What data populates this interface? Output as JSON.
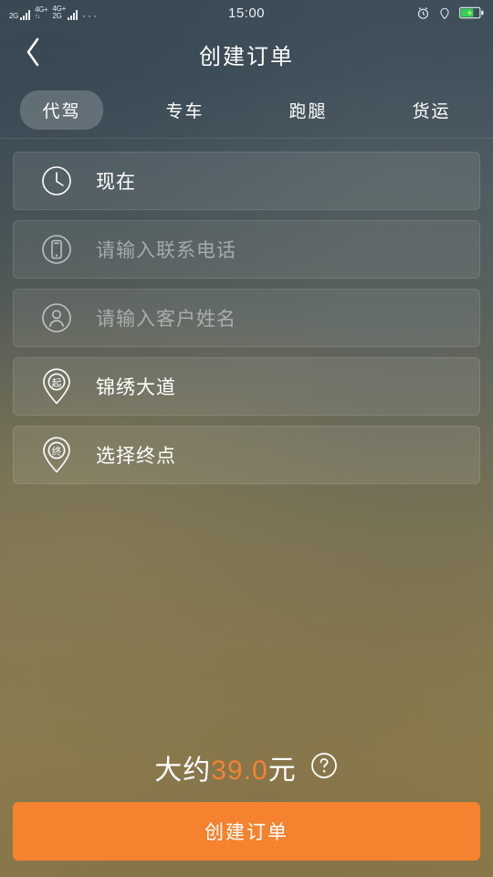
{
  "status_bar": {
    "sim1_network": "2G",
    "sim2_network": "4G+",
    "sim3_network": "4G+",
    "sim3_network_sub": "2G",
    "overflow": "···",
    "time": "15:00",
    "icons": [
      "alarm-icon",
      "location-icon",
      "battery-charging-icon"
    ]
  },
  "header": {
    "back_icon": "chevron-left-icon",
    "title": "创建订单"
  },
  "tabs": [
    {
      "label": "代驾",
      "active": true
    },
    {
      "label": "专车",
      "active": false
    },
    {
      "label": "跑腿",
      "active": false
    },
    {
      "label": "货运",
      "active": false
    }
  ],
  "form": {
    "rows": [
      {
        "icon": "clock-icon",
        "value": "现在",
        "placeholder": "",
        "is_placeholder": false
      },
      {
        "icon": "phone-icon",
        "value": "",
        "placeholder": "请输入联系电话",
        "is_placeholder": true
      },
      {
        "icon": "person-icon",
        "value": "",
        "placeholder": "请输入客户姓名",
        "is_placeholder": true
      },
      {
        "icon": "pin-start-icon",
        "pin_label": "起",
        "value": "锦绣大道",
        "placeholder": "",
        "is_placeholder": false
      },
      {
        "icon": "pin-end-icon",
        "pin_label": "终",
        "value": "选择终点",
        "placeholder": "",
        "is_placeholder": false
      }
    ]
  },
  "footer": {
    "price_prefix": "大约",
    "price_amount": "39.0",
    "price_unit": "元",
    "help_icon": "question-mark-icon",
    "cta_label": "创建订单"
  },
  "colors": {
    "accent": "#F5822F",
    "text_primary": "#FFFFFF",
    "text_placeholder": "rgba(255,255,255,0.45)",
    "battery": "#2FD35A"
  }
}
